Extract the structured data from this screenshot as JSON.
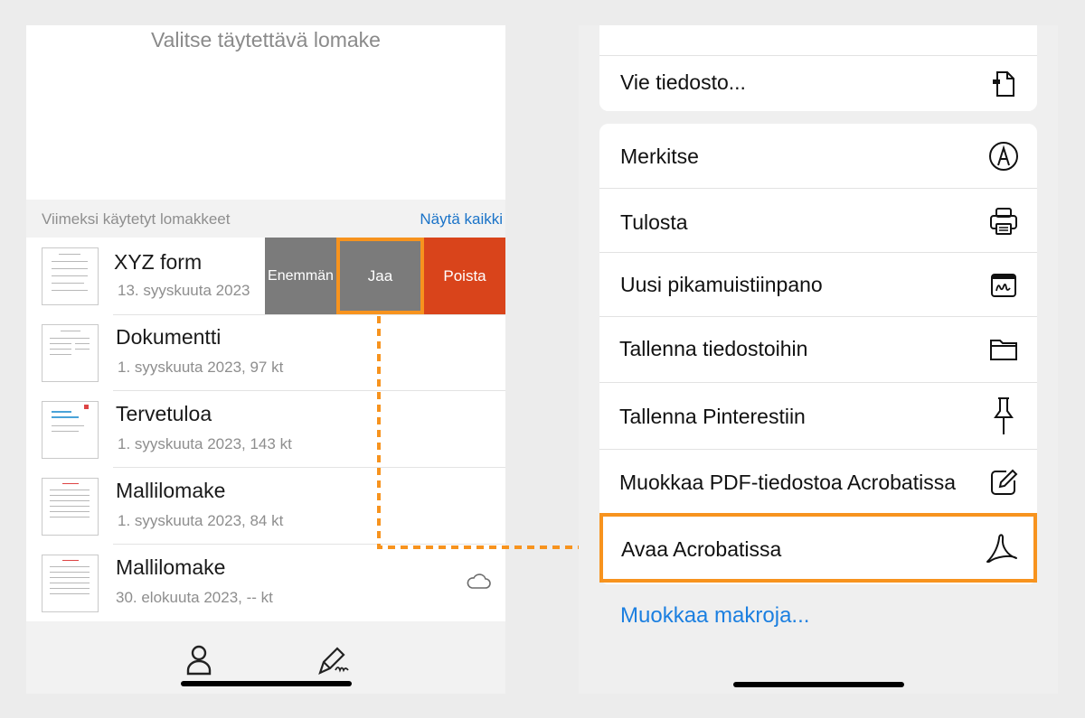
{
  "left_phone": {
    "title": "Valitse täytettävä lomake",
    "recent_label": "Viimeksi käytetyt lomakkeet",
    "show_all": "Näytä kaikki",
    "files": [
      {
        "name": "XYZ form",
        "meta": "13. syyskuuta 2023"
      },
      {
        "name": "Dokumentti",
        "meta": "1. syyskuuta 2023, 97 kt"
      },
      {
        "name": "Tervetuloa",
        "meta": "1. syyskuuta 2023, 143 kt"
      },
      {
        "name": "Mallilomake",
        "meta": "1. syyskuuta 2023, 84 kt"
      },
      {
        "name": "Mallilomake",
        "meta": "30. elokuuta 2023, -- kt"
      }
    ],
    "swipe_actions": {
      "more": "Enemmän",
      "share": "Jaa",
      "delete": "Poista"
    },
    "tabs": [
      "person-icon",
      "sign-icon"
    ]
  },
  "right_phone": {
    "export_label": "Vie tiedosto...",
    "actions": [
      {
        "label": "Merkitse",
        "icon": "markup-icon"
      },
      {
        "label": "Tulosta",
        "icon": "printer-icon"
      },
      {
        "label": "Uusi pikamuistiinpano",
        "icon": "quick-note-icon"
      },
      {
        "label": "Tallenna tiedostoihin",
        "icon": "folder-icon"
      },
      {
        "label": "Tallenna Pinterestiin",
        "icon": "pushpin-icon"
      },
      {
        "label": "Muokkaa PDF-tiedostoa Acrobatissa",
        "icon": "edit-icon"
      }
    ],
    "highlighted_action": {
      "label": "Avaa Acrobatissa",
      "icon": "acrobat-icon"
    },
    "edit_macros": "Muokkaa makroja..."
  },
  "colors": {
    "highlight": "#f7931e",
    "link": "#1b7fe0",
    "delete": "#d9441b",
    "swipe_gray": "#7b7b7b"
  }
}
